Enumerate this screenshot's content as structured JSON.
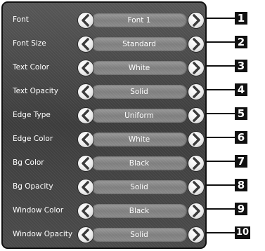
{
  "rows": [
    {
      "label": "Font",
      "value": "Font 1",
      "callout": "1"
    },
    {
      "label": "Font Size",
      "value": "Standard",
      "callout": "2"
    },
    {
      "label": "Text Color",
      "value": "White",
      "callout": "3"
    },
    {
      "label": "Text Opacity",
      "value": "Solid",
      "callout": "4"
    },
    {
      "label": "Edge Type",
      "value": "Uniform",
      "callout": "5"
    },
    {
      "label": "Edge Color",
      "value": "White",
      "callout": "6"
    },
    {
      "label": "Bg Color",
      "value": "Black",
      "callout": "7"
    },
    {
      "label": "Bg Opacity",
      "value": "Solid",
      "callout": "8"
    },
    {
      "label": "Window Color",
      "value": "Black",
      "callout": "9"
    },
    {
      "label": "Window Opacity",
      "value": "Solid",
      "callout": "10"
    }
  ],
  "icons": {
    "prev": "chevron-left-icon",
    "next": "chevron-right-icon"
  }
}
